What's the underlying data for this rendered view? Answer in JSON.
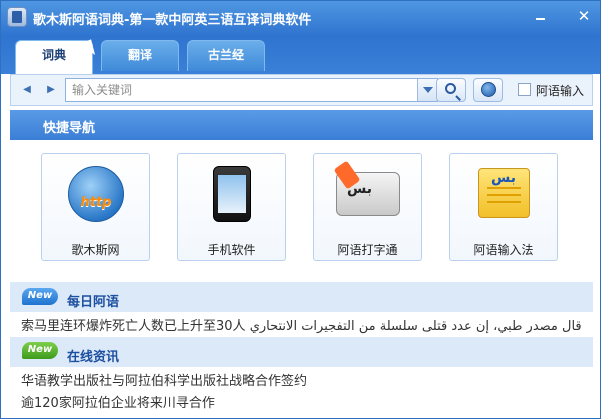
{
  "window": {
    "title": "歌木斯阿语词典-第一款中阿英三语互译词典软件"
  },
  "tabs": [
    {
      "label": "词典"
    },
    {
      "label": "翻译"
    },
    {
      "label": "古兰经"
    }
  ],
  "search": {
    "placeholder": "输入关键词",
    "value": "",
    "arabic_input_label": "阿语输入"
  },
  "quick_nav": {
    "title": "快捷导航",
    "items": [
      {
        "label": "歌木斯网",
        "icon": "http-globe-icon",
        "icon_text": "http"
      },
      {
        "label": "手机软件",
        "icon": "smartphone-icon"
      },
      {
        "label": "阿语打字通",
        "icon": "keyboard-pencil-icon",
        "icon_text": "بس"
      },
      {
        "label": "阿语输入法",
        "icon": "note-icon",
        "icon_text": "بس"
      }
    ]
  },
  "daily": {
    "badge": "New",
    "title": "每日阿语",
    "text": "索马里连环爆炸死亡人数已上升至30人 قال مصدر طبي، إن عدد قتلى سلسلة من التفجيرات الانتحاري ..."
  },
  "news": {
    "badge": "New",
    "title": "在线资讯",
    "items": [
      "华语教学出版社与阿拉伯科学出版社战略合作签约",
      "逾120家阿拉伯企业将来川寻合作",
      "……"
    ]
  },
  "colors": {
    "titlebar": "#2f74cf",
    "accent": "#3a7ed6",
    "section_bg": "#dbe9f8",
    "new_blue": "#1f73cf",
    "new_green": "#3e9a1c"
  }
}
